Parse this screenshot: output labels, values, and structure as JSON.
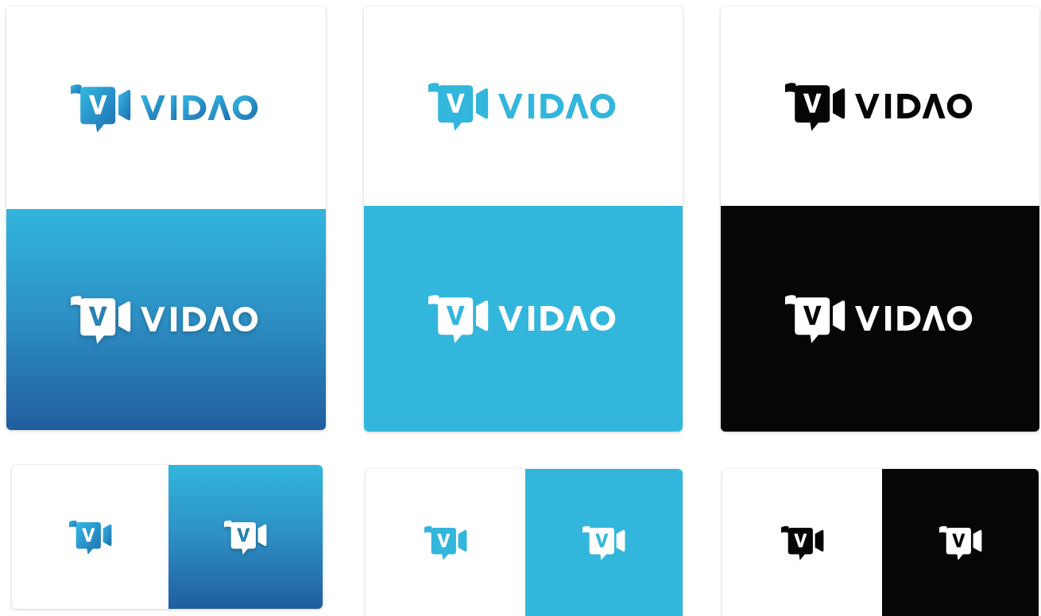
{
  "brand": {
    "name": "VIDAO",
    "mark_letter": "V"
  },
  "colors": {
    "cyan": "#33b6db",
    "blue_gradient_top": "#32b5dc",
    "blue_gradient_bottom": "#205d9e",
    "black": "#060606",
    "white": "#ffffff"
  },
  "variants": [
    {
      "name": "gradient-blue",
      "light_logo_fill": "blue-gradient",
      "dark_background": "blue-gradient"
    },
    {
      "name": "flat-cyan",
      "light_logo_fill": "cyan",
      "dark_background": "cyan"
    },
    {
      "name": "monochrome-black",
      "light_logo_fill": "black",
      "dark_background": "black"
    }
  ],
  "icons": [
    "vidao-logo-icon",
    "speech-bubble-camera-icon"
  ]
}
